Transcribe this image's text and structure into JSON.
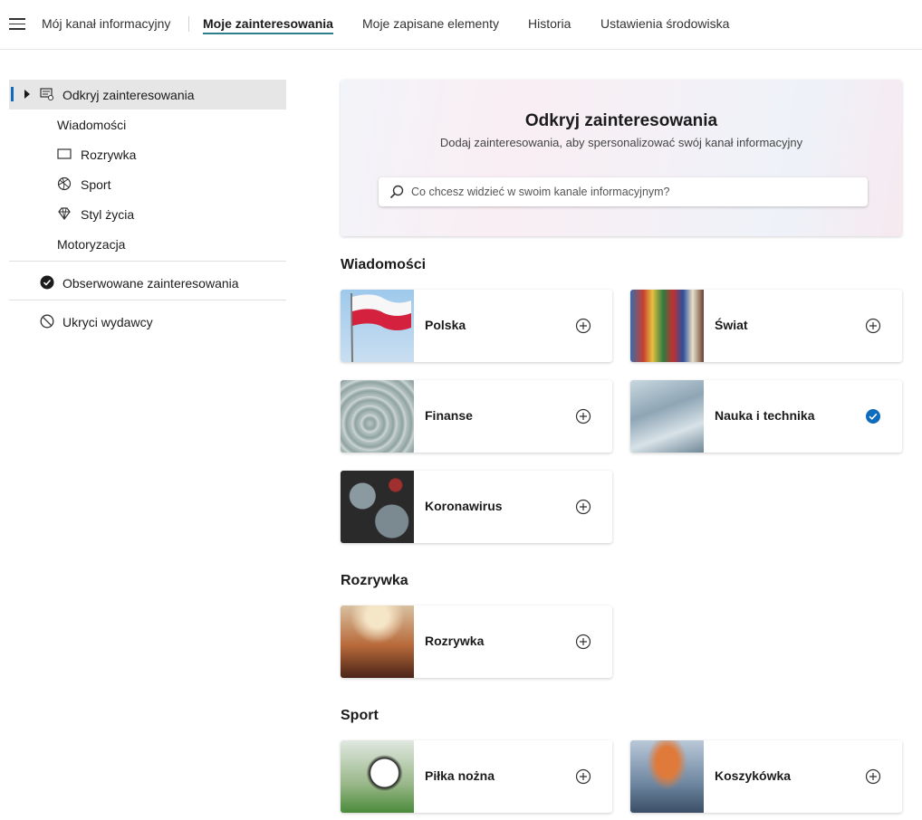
{
  "topnav": {
    "items": [
      {
        "label": "Mój kanał informacyjny",
        "active": false
      },
      {
        "label": "Moje zainteresowania",
        "active": true
      },
      {
        "label": "Moje zapisane elementy",
        "active": false
      },
      {
        "label": "Historia",
        "active": false
      },
      {
        "label": "Ustawienia środowiska",
        "active": false
      }
    ],
    "accent": "#2e7d8c"
  },
  "sidebar": {
    "discover": {
      "label": "Odkryj zainteresowania",
      "icon": "discover-icon"
    },
    "items": [
      {
        "label": "Wiadomości",
        "icon": null
      },
      {
        "label": "Rozrywka",
        "icon": "tv-icon"
      },
      {
        "label": "Sport",
        "icon": "ball-icon"
      },
      {
        "label": "Styl życia",
        "icon": "diamond-icon"
      },
      {
        "label": "Motoryzacja",
        "icon": null
      }
    ],
    "followed": {
      "label": "Obserwowane zainteresowania",
      "icon": "check-circle-icon"
    },
    "hidden": {
      "label": "Ukryci wydawcy",
      "icon": "block-icon"
    }
  },
  "hero": {
    "title": "Odkryj zainteresowania",
    "subtitle": "Dodaj zainteresowania, aby spersonalizować swój kanał informacyjny",
    "search_placeholder": "Co chcesz widzieć w swoim kanale informacyjnym?"
  },
  "sections": [
    {
      "title": "Wiadomości",
      "cards": [
        {
          "label": "Polska",
          "followed": false
        },
        {
          "label": "Świat",
          "followed": false
        },
        {
          "label": "Finanse",
          "followed": false
        },
        {
          "label": "Nauka i technika",
          "followed": true
        },
        {
          "label": "Koronawirus",
          "followed": false
        }
      ]
    },
    {
      "title": "Rozrywka",
      "cards": [
        {
          "label": "Rozrywka",
          "followed": false
        }
      ]
    },
    {
      "title": "Sport",
      "cards": [
        {
          "label": "Piłka nożna",
          "followed": false
        },
        {
          "label": "Koszykówka",
          "followed": false
        }
      ]
    }
  ],
  "colors": {
    "followed_check": "#0f6cbd",
    "selected_indicator": "#0f6cbd"
  }
}
